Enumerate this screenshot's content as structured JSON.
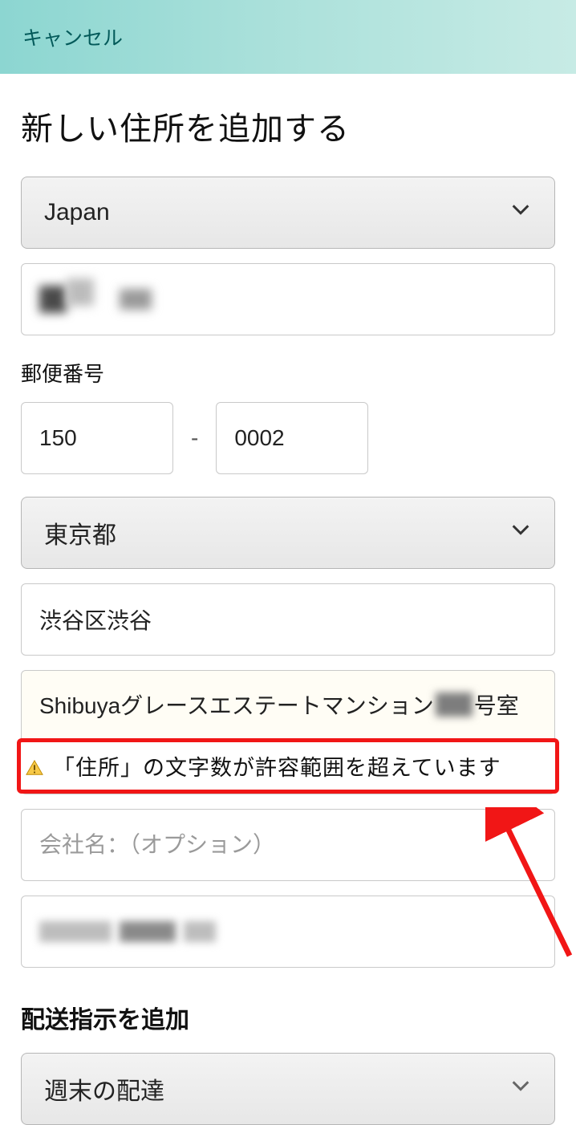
{
  "header": {
    "cancel": "キャンセル"
  },
  "title": "新しい住所を追加する",
  "country": {
    "selected": "Japan"
  },
  "postal": {
    "label": "郵便番号",
    "part1": "150",
    "part2": "0002",
    "dash": "-"
  },
  "prefecture": {
    "selected": "東京都"
  },
  "address_line1": "渋谷区渋谷",
  "address_line2_prefix": "Shibuyaグレースエステートマンション",
  "address_line2_suffix": "号室",
  "error": {
    "message": "「住所」の文字数が許容範囲を超えています"
  },
  "company": {
    "placeholder": "会社名：（オプション）"
  },
  "delivery_section": {
    "heading": "配送指示を追加",
    "selected": "週末の配達"
  }
}
